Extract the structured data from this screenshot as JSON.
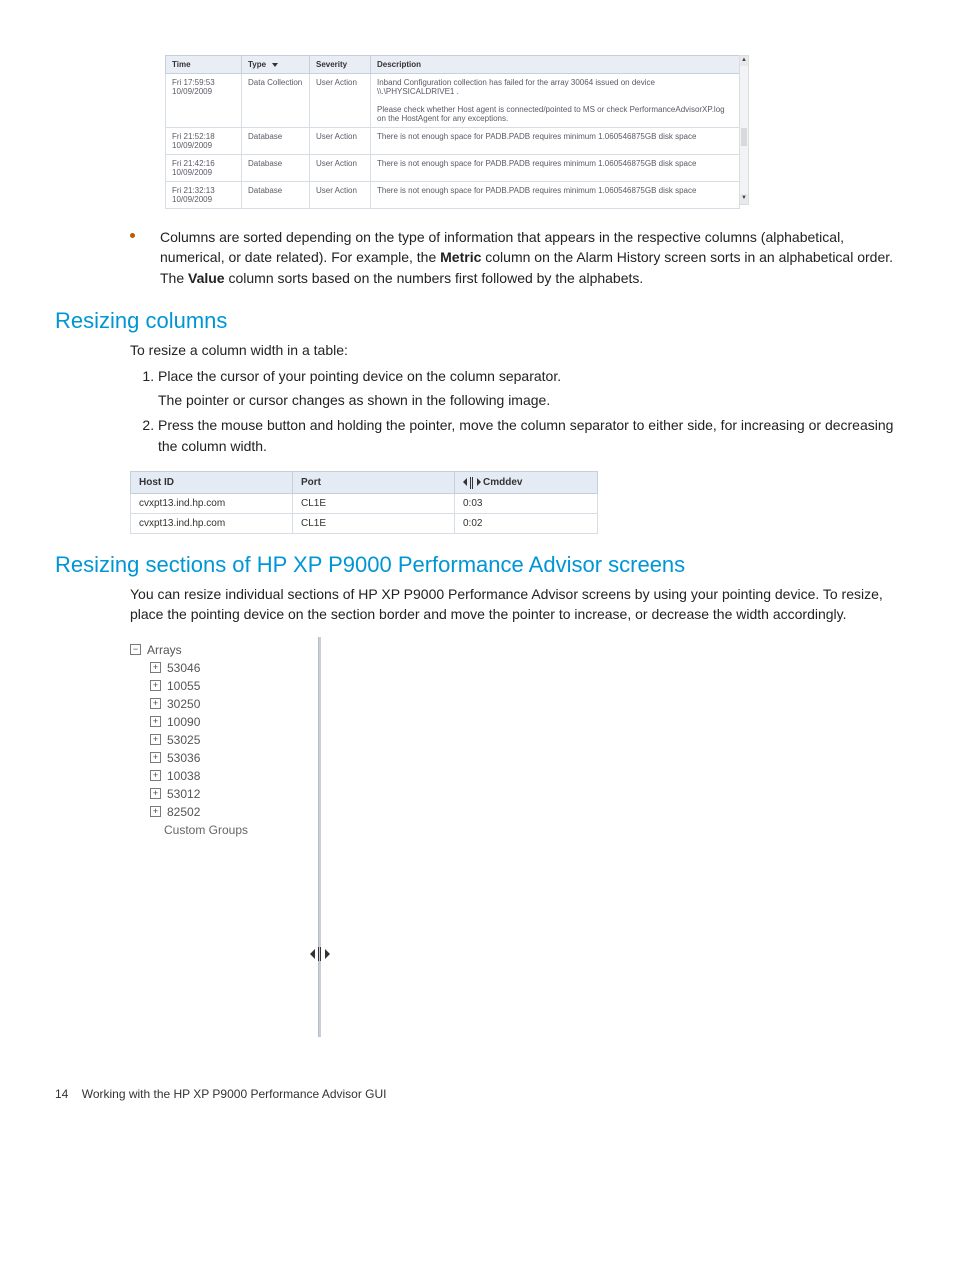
{
  "fig1": {
    "headers": {
      "time": "Time",
      "type": "Type",
      "severity": "Severity",
      "description": "Description"
    },
    "rows": [
      {
        "time": "Fri 17:59:53 10/09/2009",
        "type": "Data Collection",
        "sev": "User Action",
        "desc": "Inband Configuration collection has failed for the array 30064 issued on device \\\\.\\PHYSICALDRIVE1 .\n\nPlease check whether Host agent is connected/pointed to MS  or check PerformanceAdvisorXP.log on the HostAgent for any exceptions."
      },
      {
        "time": "Fri 21:52:18 10/09/2009",
        "type": "Database",
        "sev": "User Action",
        "desc": "There is not enough space for PADB.PADB requires minimum 1.060546875GB disk space"
      },
      {
        "time": "Fri 21:42:16 10/09/2009",
        "type": "Database",
        "sev": "User Action",
        "desc": "There is not enough space for PADB.PADB requires minimum 1.060546875GB disk space"
      },
      {
        "time": "Fri 21:32:13 10/09/2009",
        "type": "Database",
        "sev": "User Action",
        "desc": "There is not enough space for PADB.PADB requires minimum 1.060546875GB disk space"
      }
    ]
  },
  "bullet": {
    "pre": "Columns are sorted depending on the type of information that appears in the respective columns (alphabetical, numerical, or date related). For example, the ",
    "b1": "Metric",
    "mid": " column on the Alarm History screen sorts in an alphabetical order. The ",
    "b2": "Value",
    "post": " column sorts based on the numbers first followed by the alphabets."
  },
  "h1": "Resizing columns",
  "p1": "To resize a column width in a table:",
  "steps": [
    {
      "main": "Place the cursor of your pointing device on the column separator.",
      "sub": "The pointer or cursor changes as shown in the following image."
    },
    {
      "main": "Press the mouse button and holding the pointer, move the column separator to either side, for increasing or decreasing the column width."
    }
  ],
  "fig2": {
    "headers": {
      "host": "Host ID",
      "port": "Port",
      "cmd": "Cmddev"
    },
    "rows": [
      {
        "host": "cvxpt13.ind.hp.com",
        "port": "CL1E",
        "cmd": "0:03"
      },
      {
        "host": "cvxpt13.ind.hp.com",
        "port": "CL1E",
        "cmd": "0:02"
      }
    ]
  },
  "h2": "Resizing sections of HP XP P9000 Performance Advisor screens",
  "p2": "You can resize individual sections of HP XP P9000 Performance Advisor screens by using your pointing device. To resize, place the pointing device on the section border and move the pointer to increase, or decrease the width accordingly.",
  "tree": {
    "root": "Arrays",
    "children": [
      "53046",
      "10055",
      "30250",
      "10090",
      "53025",
      "53036",
      "10038",
      "53012",
      "82502"
    ],
    "leaf": "Custom Groups"
  },
  "footer": {
    "page": "14",
    "title": "Working with the HP XP P9000 Performance Advisor GUI"
  }
}
